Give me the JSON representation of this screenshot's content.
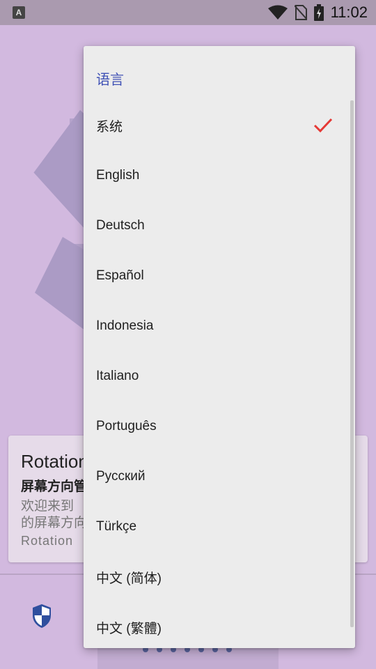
{
  "status_bar": {
    "time": "11:02",
    "notification_badge": "A",
    "icons": [
      "wifi-icon",
      "no-sim-icon",
      "battery-charging-icon"
    ]
  },
  "background": {
    "card": {
      "title": "Rotation",
      "subtitle": "屏幕方向管",
      "body_line1": "欢迎来到",
      "body_line2": "的屏幕方向",
      "footer": "Rotation"
    },
    "bottom_icon": "shield-icon",
    "pager_dots": 7
  },
  "language_menu": {
    "title": "语言",
    "selected_index": 0,
    "items": [
      {
        "label": "系统"
      },
      {
        "label": "English"
      },
      {
        "label": "Deutsch"
      },
      {
        "label": "Español"
      },
      {
        "label": "Indonesia"
      },
      {
        "label": "Italiano"
      },
      {
        "label": "Português"
      },
      {
        "label": "Русский"
      },
      {
        "label": "Türkçe"
      },
      {
        "label": "中文 (简体)"
      },
      {
        "label": "中文 (繁體)"
      }
    ]
  },
  "colors": {
    "accent": "#3f51b5",
    "check": "#e53935",
    "app_background": "#d2b9df",
    "menu_background": "#ececec"
  }
}
